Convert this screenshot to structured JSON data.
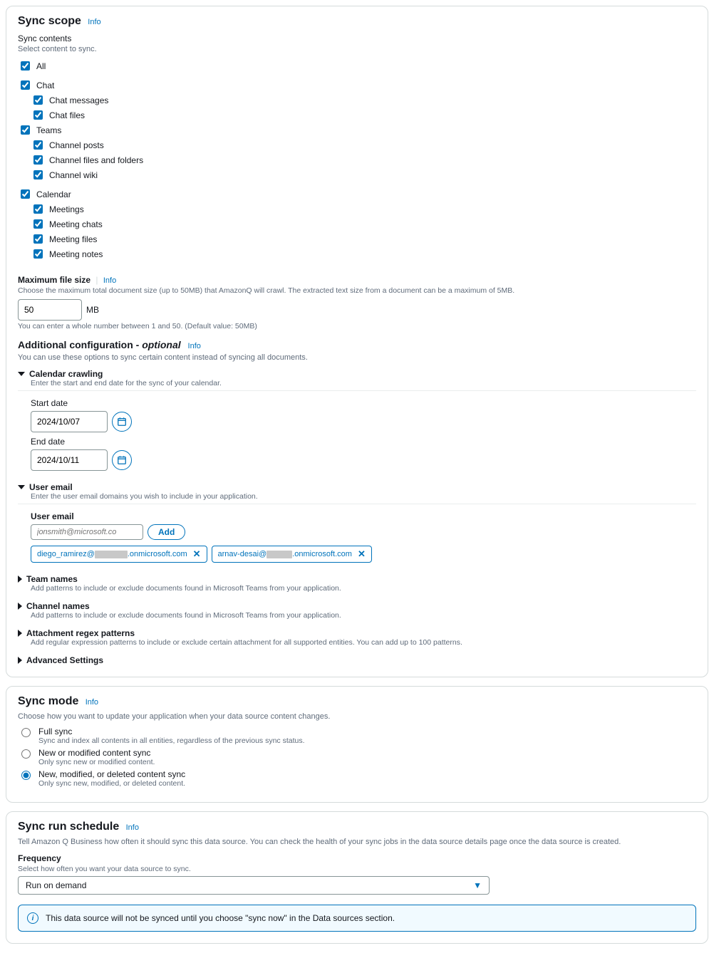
{
  "syncScope": {
    "title": "Sync scope",
    "info": "Info",
    "subHeading": "Sync contents",
    "desc": "Select content to sync.",
    "all": "All",
    "chat": "Chat",
    "chatMessages": "Chat messages",
    "chatFiles": "Chat files",
    "teams": "Teams",
    "channelPosts": "Channel posts",
    "channelFilesFolders": "Channel files and folders",
    "channelWiki": "Channel wiki",
    "calendar": "Calendar",
    "meetings": "Meetings",
    "meetingChats": "Meeting chats",
    "meetingFiles": "Meeting files",
    "meetingNotes": "Meeting notes",
    "maxFileSizeLabel": "Maximum file size",
    "maxFileSizeDesc": "Choose the maximum total document size (up to 50MB) that AmazonQ will crawl. The extracted text size from a document can be a maximum of 5MB.",
    "maxFileSizeValue": "50",
    "mbUnit": "MB",
    "maxFileSizeHint": "You can enter a whole number between 1 and 50. (Default value: 50MB)",
    "additionalTitle": "Additional configuration - ",
    "additionalOptional": "optional",
    "additionalDesc": "You can use these options to sync certain content instead of syncing all documents.",
    "calendarCrawling": "Calendar crawling",
    "calendarCrawlingDesc": "Enter the start and end date for the sync of your calendar.",
    "startDateLabel": "Start date",
    "startDateValue": "2024/10/07",
    "endDateLabel": "End date",
    "endDateValue": "2024/10/11",
    "userEmailTitle": "User email",
    "userEmailDesc": "Enter the user email domains you wish to include in your application.",
    "userEmailFieldLabel": "User email",
    "userEmailPlaceholder": "jonsmith@microsoft.co",
    "addBtn": "Add",
    "tag1Prefix": "diego_ramirez@",
    "tag1Suffix": ".onmicrosoft.com",
    "tag2Prefix": "arnav-desai@",
    "tag2Suffix": ".onmicrosoft.com",
    "teamNames": "Team names",
    "teamNamesDesc": "Add patterns to include or exclude documents found in Microsoft Teams from your application.",
    "channelNames": "Channel names",
    "channelNamesDesc": "Add patterns to include or exclude documents found in Microsoft Teams from your application.",
    "attachRegex": "Attachment regex patterns",
    "attachRegexDesc": "Add regular expression patterns to include or exclude certain attachment for all supported entities. You can add up to 100 patterns.",
    "advancedSettings": "Advanced Settings"
  },
  "syncMode": {
    "title": "Sync mode",
    "info": "Info",
    "desc": "Choose how you want to update your application when your data source content changes.",
    "fullSync": "Full sync",
    "fullSyncDesc": "Sync and index all contents in all entities, regardless of the previous sync status.",
    "newMod": "New or modified content sync",
    "newModDesc": "Only sync new or modified content.",
    "newModDel": "New, modified, or deleted content sync",
    "newModDelDesc": "Only sync new, modified, or deleted content."
  },
  "syncSchedule": {
    "title": "Sync run schedule",
    "info": "Info",
    "desc": "Tell Amazon Q Business how often it should sync this data source. You can check the health of your sync jobs in the data source details page once the data source is created.",
    "freqLabel": "Frequency",
    "freqDesc": "Select how often you want your data source to sync.",
    "freqValue": "Run on demand",
    "bannerText": "This data source will not be synced until you choose \"sync now\" in the Data sources section."
  }
}
